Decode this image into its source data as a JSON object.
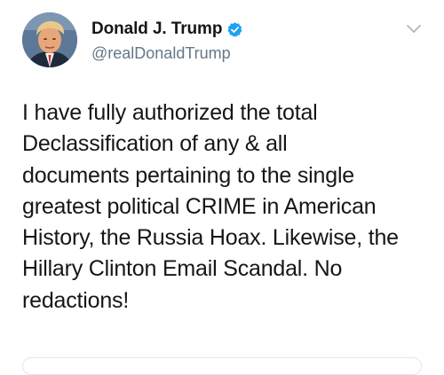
{
  "tweet": {
    "display_name": "Donald J. Trump",
    "handle": "@realDonaldTrump",
    "verified": true,
    "text_lines": [
      "I have fully authorized the total",
      "Declassification of any & all",
      "documents pertaining to the single",
      "greatest political CRIME in American",
      "History, the Russia Hoax. Likewise, the",
      "Hillary Clinton Email Scandal. No",
      "redactions!"
    ]
  },
  "icons": {
    "verified": "verified-badge-icon",
    "menu": "chevron-down-icon"
  },
  "colors": {
    "verified_blue": "#1da1f2",
    "handle_gray": "#657786",
    "text": "#14171a",
    "caret_gray": "#aab8c2"
  }
}
